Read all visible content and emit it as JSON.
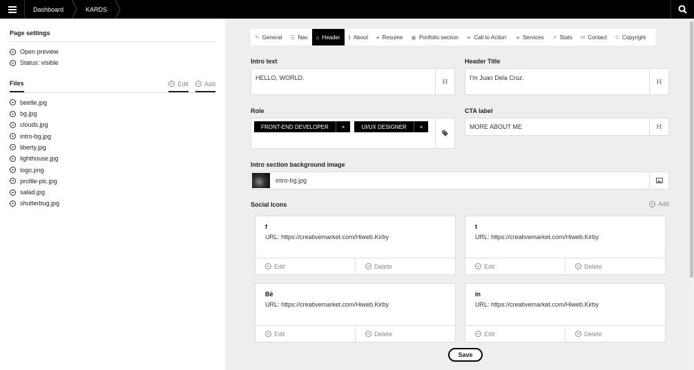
{
  "topbar": {
    "crumbs": [
      "Dashboard",
      "KARDS"
    ]
  },
  "sidebar": {
    "page_settings_title": "Page settings",
    "page_settings_items": [
      {
        "label": "Open preview"
      },
      {
        "label": "Status: visible"
      }
    ],
    "files_title": "Files",
    "edit_label": "Edit",
    "add_label": "Add",
    "files": [
      "beetle.jpg",
      "bg.jpg",
      "clouds.jpg",
      "intro-bg.jpg",
      "liberty.jpg",
      "lighthouse.jpg",
      "logo.png",
      "profile-pic.jpg",
      "salad.jpg",
      "shutterbug.jpg"
    ]
  },
  "tabs": [
    {
      "label": "General",
      "icon": "wrench-icon",
      "glyph": "✎"
    },
    {
      "label": "Nav",
      "icon": "list-icon",
      "glyph": "☰"
    },
    {
      "label": "Header",
      "icon": "home-icon",
      "glyph": "⌂",
      "active": true
    },
    {
      "label": "About",
      "icon": "info-icon",
      "glyph": "ℹ"
    },
    {
      "label": "Resume",
      "icon": "user-icon",
      "glyph": "●"
    },
    {
      "label": "Portfolio section",
      "icon": "image-icon",
      "glyph": "▣"
    },
    {
      "label": "Call to Action",
      "icon": "pointer-icon",
      "glyph": "➤"
    },
    {
      "label": "Services",
      "icon": "bullhorn-icon",
      "glyph": "◄"
    },
    {
      "label": "Stats",
      "icon": "chart-icon",
      "glyph": "↗"
    },
    {
      "label": "Contact",
      "icon": "envelope-icon",
      "glyph": "✉"
    },
    {
      "label": "Copyright",
      "icon": "copyright-icon",
      "glyph": "©"
    }
  ],
  "form": {
    "intro_text_label": "Intro text",
    "intro_text_value": "HELLO, WORLD.",
    "header_title_label": "Header Title",
    "header_title_value": "I'm Juan Dela Cruz.",
    "role_label": "Role",
    "role_tags": [
      "FRONT-END DEVELOPER",
      "UI/UX DESIGNER"
    ],
    "cta_label": "CTA label",
    "cta_value": "MORE ABOUT ME",
    "heading_glyph": "H",
    "bg_image_label": "Intro section background image",
    "bg_image_value": "intro-bg.jpg"
  },
  "social": {
    "title": "Social Icons",
    "add_label": "Add",
    "edit_label": "Edit",
    "delete_label": "Delete",
    "cards": [
      {
        "brand": "f",
        "url": "URL: https://creativemarket.com/Hiweb.Kirby"
      },
      {
        "brand": "t",
        "url": "URL: https://creativemarket.com/Hiweb.Kirby"
      },
      {
        "brand": "Bē",
        "url": "URL: https://creativemarket.com/Hiweb.Kirby"
      },
      {
        "brand": "in",
        "url": "URL: https://creativemarket.com/Hiweb.Kirby"
      }
    ]
  },
  "save_label": "Save"
}
